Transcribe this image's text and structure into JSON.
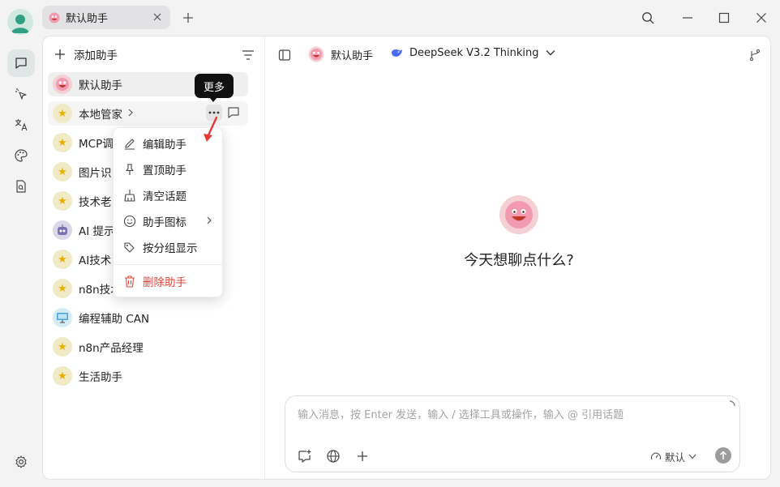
{
  "titlebar": {
    "tab_label": "默认助手"
  },
  "sidebar": {
    "add_label": "添加助手",
    "items": [
      {
        "label": "默认助手",
        "icon": "smiley-face-icon"
      },
      {
        "label": "本地管家",
        "icon": "star-icon"
      },
      {
        "label": "MCP调",
        "icon": "star-icon"
      },
      {
        "label": "图片识",
        "icon": "star-icon"
      },
      {
        "label": "技术老",
        "icon": "star-icon"
      },
      {
        "label": "AI 提示",
        "icon": "robot-icon"
      },
      {
        "label": "AI技术",
        "icon": "star-icon"
      },
      {
        "label": "n8n技术",
        "icon": "star-icon"
      },
      {
        "label": "编程辅助 CAN",
        "icon": "computer-icon"
      },
      {
        "label": "n8n产品经理",
        "icon": "star-icon"
      },
      {
        "label": "生活助手",
        "icon": "star-icon"
      }
    ],
    "tooltip": "更多"
  },
  "menu": {
    "items": [
      {
        "label": "编辑助手",
        "icon": "pencil-icon"
      },
      {
        "label": "置顶助手",
        "icon": "pin-icon"
      },
      {
        "label": "清空话题",
        "icon": "broom-icon"
      },
      {
        "label": "助手图标",
        "icon": "smile-icon"
      },
      {
        "label": "按分组显示",
        "icon": "tags-icon"
      },
      {
        "label": "删除助手",
        "icon": "trash-icon"
      }
    ]
  },
  "chat": {
    "assistant_label": "默认助手",
    "model_label": "DeepSeek V3.2 Thinking",
    "welcome": "今天想聊点什么?",
    "input_placeholder": "输入消息，按 Enter 发送，输入 / 选择工具或操作，输入 @ 引用话题",
    "mode_label": "默认"
  },
  "colors": {
    "danger": "#e0443a",
    "star": "#e8b000",
    "rail_active": "#e0e6e5"
  }
}
